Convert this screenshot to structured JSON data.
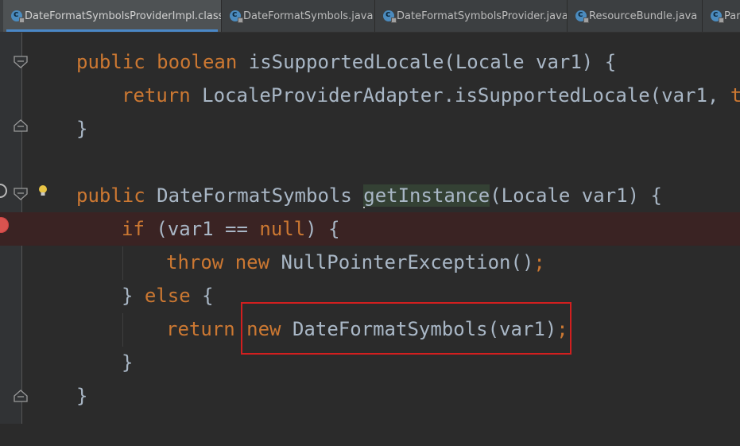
{
  "tabs": [
    {
      "label": "DateFormatSymbolsProviderImpl.class",
      "active": true,
      "close": "×"
    },
    {
      "label": "DateFormatSymbols.java",
      "active": false,
      "close": "×"
    },
    {
      "label": "DateFormatSymbolsProvider.java",
      "active": false,
      "close": "×"
    },
    {
      "label": "ResourceBundle.java",
      "active": false,
      "close": "×"
    },
    {
      "label": "Para",
      "active": false,
      "close": ""
    }
  ],
  "code": {
    "l1": {
      "kw1": "public",
      "kw2": "boolean",
      "rest": " isSupportedLocale(Locale var1) {"
    },
    "l2": {
      "kw": "return",
      "rest": " LocaleProviderAdapter.isSupportedLocale(var1, ",
      "kw2": "thi"
    },
    "l3": {
      "text": "}"
    },
    "l4": {
      "kw": "public",
      "mid": " DateFormatSymbols ",
      "sel": "getInstance",
      "rest": "(Locale var1) {"
    },
    "l5": {
      "kw": "if",
      "mid": " (var1 == ",
      "kw2": "null",
      "rest": ") {"
    },
    "l6": {
      "kw1": "throw",
      "kw2": "new",
      "rest": " NullPointerException()",
      "semi": ";"
    },
    "l7": {
      "brace": "} ",
      "kw": "else",
      "rest": " {"
    },
    "l8": {
      "kw1": "return",
      "kw2": "new",
      "rest": " DateFormatSymbols(var1)",
      "semi": ";"
    },
    "l9": {
      "text": "}"
    },
    "l10": {
      "text": "}"
    }
  },
  "colors": {
    "background": "#2b2b2b",
    "keyword": "#cc7832",
    "text": "#a9b7c6",
    "highlight_row": "#3a2323",
    "breakpoint": "#d9534f",
    "annotation_box": "#d21f1f"
  },
  "icons": [
    "class-file-icon",
    "java-file-icon",
    "fold-icon",
    "breakpoint-icon",
    "lightbulb-icon",
    "close-icon"
  ]
}
